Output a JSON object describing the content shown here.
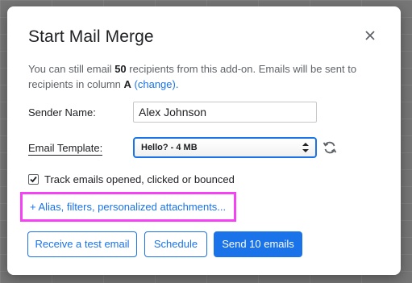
{
  "dialog": {
    "title": "Start Mail Merge",
    "info": {
      "line1_prefix": "You can still email",
      "count": "50",
      "line1_suffix": "recipients from this add-on. Emails will be sent to",
      "line2_prefix": "recipients in column",
      "column": "A",
      "change_link": "(change)."
    },
    "sender": {
      "label": "Sender Name:",
      "value": "Alex Johnson"
    },
    "template": {
      "label": "Email Template:",
      "selected": "Hello? - 4 MB"
    },
    "tracking": {
      "label": "Track emails opened, clicked or bounced",
      "checked": true
    },
    "advanced_link": "+ Alias, filters, personalized attachments...",
    "buttons": {
      "test_email": "Receive a test email",
      "schedule": "Schedule",
      "send": "Send 10 emails"
    }
  },
  "colors": {
    "accent": "#1a73e8",
    "highlight": "#f542f5"
  }
}
